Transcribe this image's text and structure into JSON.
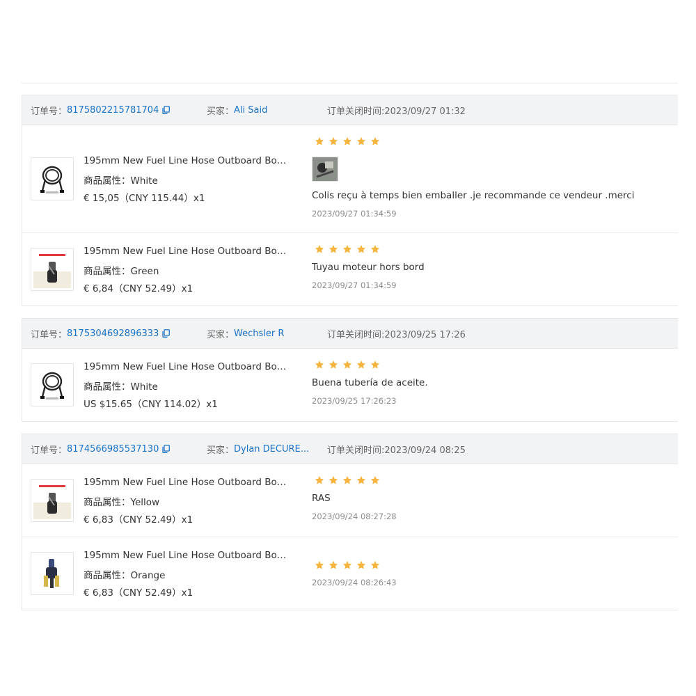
{
  "labels": {
    "order_no": "订单号：",
    "buyer": "买家：",
    "closed_time": "订单关闭时间:",
    "attr": "商品属性："
  },
  "colors": {
    "link": "#1a73c8",
    "star": "#f5b53f",
    "header_bg": "#f2f3f5"
  },
  "orders": [
    {
      "order_id": "8175802215781704",
      "buyer": "Ali Said",
      "closed_time": "2023/09/27 01:32",
      "items": [
        {
          "title": "195mm New Fuel Line Hose Outboard Boa...",
          "attr_value": "White",
          "price": "€ 15,05（CNY  115.44）x1",
          "thumb_icon": "fuel-hose-coiled-image",
          "rating": 5,
          "has_photo": true,
          "review": "Colis reçu à temps bien emballer .je recommande ce vendeur .merci",
          "review_date": "2023/09/27 01:34:59"
        },
        {
          "title": "195mm New Fuel Line Hose Outboard Boa...",
          "attr_value": "Green",
          "price": "€ 6,84（CNY  52.49）x1",
          "thumb_icon": "fuel-connector-image",
          "rating": 5,
          "has_photo": false,
          "review": "Tuyau moteur hors bord",
          "review_date": "2023/09/27 01:34:59"
        }
      ]
    },
    {
      "order_id": "8175304692896333",
      "buyer": "Wechsler R",
      "closed_time": "2023/09/25 17:26",
      "items": [
        {
          "title": "195mm New Fuel Line Hose Outboard Boa...",
          "attr_value": "White",
          "price": "US $15.65（CNY  114.02）x1",
          "thumb_icon": "fuel-hose-coiled-image",
          "rating": 5,
          "has_photo": false,
          "review": "Buena tubería de aceite.",
          "review_date": "2023/09/25 17:26:23"
        }
      ]
    },
    {
      "order_id": "8174566985537130",
      "buyer": "Dylan DECURE...",
      "closed_time": "2023/09/24 08:25",
      "items": [
        {
          "title": "195mm New Fuel Line Hose Outboard Boa...",
          "attr_value": "Yellow",
          "price": "€ 6,83（CNY  52.49）x1",
          "thumb_icon": "fuel-connector-image",
          "rating": 5,
          "has_photo": false,
          "review": "RAS",
          "review_date": "2023/09/24 08:27:28"
        },
        {
          "title": "195mm New Fuel Line Hose Outboard Boa...",
          "attr_value": "Orange",
          "price": "€ 6,83（CNY  52.49）x1",
          "thumb_icon": "fuel-fitting-image",
          "rating": 5,
          "has_photo": false,
          "review": "",
          "review_date": "2023/09/24 08:26:43"
        }
      ]
    }
  ]
}
